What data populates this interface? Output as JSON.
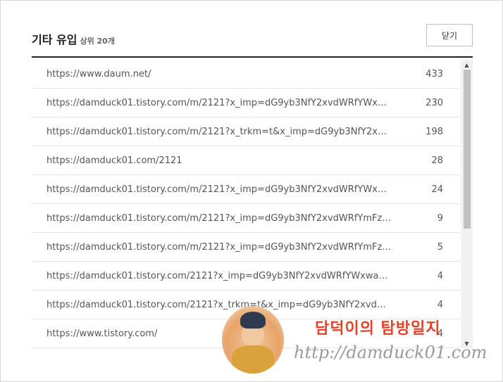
{
  "header": {
    "title": "기타 유입",
    "subtitle": "상위 20개",
    "close_label": "닫기"
  },
  "rows": [
    {
      "url": "https://www.daum.net/",
      "count": "433"
    },
    {
      "url": "https://damduck01.tistory.com/m/2121?x_imp=dG9yb3NfY2xvdWRfYWxwaGE...",
      "count": "230"
    },
    {
      "url": "https://damduck01.tistory.com/m/2121?x_trkm=t&x_imp=dG9yb3NfY2xvdWRf...",
      "count": "198"
    },
    {
      "url": "https://damduck01.com/2121",
      "count": "28"
    },
    {
      "url": "https://damduck01.tistory.com/m/2121?x_imp=dG9yb3NfY2xvdWRfYWxwaGE...",
      "count": "24"
    },
    {
      "url": "https://damduck01.tistory.com/m/2121?x_imp=dG9yb3NfY2xvdWRfYmFzZQ=...",
      "count": "9"
    },
    {
      "url": "https://damduck01.tistory.com/m/2121?x_imp=dG9yb3NfY2xvdWRfYmFzZQ=...",
      "count": "5"
    },
    {
      "url": "https://damduck01.tistory.com/2121?x_imp=dG9yb3NfY2xvdWRfYWxwaGE=&...",
      "count": "4"
    },
    {
      "url": "https://damduck01.tistory.com/2121?x_trkm=t&x_imp=dG9yb3NfY2xvdWRfY...",
      "count": "4"
    },
    {
      "url": "https://www.tistory.com/",
      "count": "4"
    }
  ],
  "watermark": {
    "title": "담덕이의 탐방일지",
    "url": "http://damduck01.com"
  }
}
